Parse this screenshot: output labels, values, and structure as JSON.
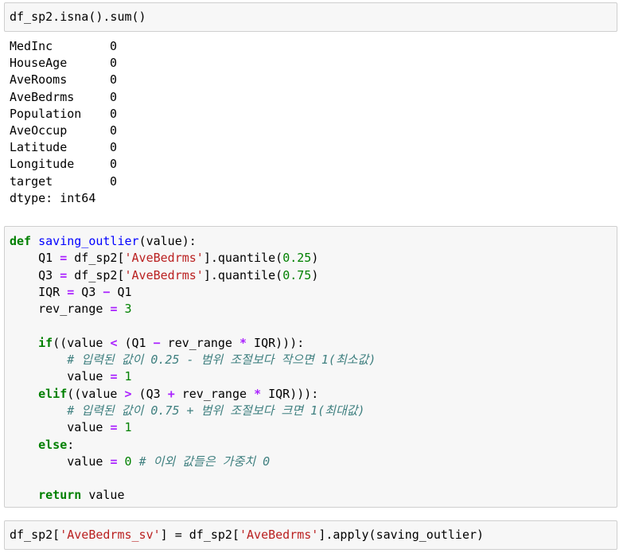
{
  "cell1": {
    "code": "df_sp2.isna().sum()"
  },
  "output": {
    "rows": [
      {
        "name": "MedInc",
        "value": "0"
      },
      {
        "name": "HouseAge",
        "value": "0"
      },
      {
        "name": "AveRooms",
        "value": "0"
      },
      {
        "name": "AveBedrms",
        "value": "0"
      },
      {
        "name": "Population",
        "value": "0"
      },
      {
        "name": "AveOccup",
        "value": "0"
      },
      {
        "name": "Latitude",
        "value": "0"
      },
      {
        "name": "Longitude",
        "value": "0"
      },
      {
        "name": "target",
        "value": "0"
      }
    ],
    "dtype": "dtype: int64"
  },
  "cell2": {
    "def_kw": "def",
    "fn_name": "saving_outlier",
    "fn_params": "(value):",
    "q1_lhs": "Q1 ",
    "q3_lhs": "Q3 ",
    "eq": "=",
    "df_index": " df_sp2[",
    "col_name": "'AveBedrms'",
    "quantile_call": "].quantile(",
    "q1_val": "0.25",
    "q3_val": "0.75",
    "close_paren": ")",
    "iqr_lhs": "IQR ",
    "iqr_rhs_a": " Q3 ",
    "minus": "−",
    "iqr_rhs_b": " Q1",
    "rev_lhs": "rev_range ",
    "rev_val": "3",
    "if_kw": "if",
    "if_a": "((value ",
    "lt": "<",
    "if_b": " (Q1 ",
    "if_c": " rev_range ",
    "mul": "*",
    "if_d": " IQR))):",
    "comment1": "# 입력된 값이 0.25 - 범위 조절보다 작으면 1(최소값)",
    "value_lhs": "value ",
    "one": "1",
    "elif_kw": "elif",
    "gt": ">",
    "elif_b": " (Q3 ",
    "plus": "+",
    "elif_d": " IQR))):",
    "comment2": "# 입력된 값이 0.75 + 범위 조절보다 크면 1(최대값)",
    "else_kw": "else",
    "colon": ":",
    "zero": "0",
    "comment3": "# 이외 값들은 가중치 0",
    "return_kw": "return",
    "return_val": " value"
  },
  "cell3": {
    "lhs": "df_sp2[",
    "new_col": "'AveBedrms_sv'",
    "mid": "] = df_sp2[",
    "col": "'AveBedrms'",
    "apply": "].apply(saving_outlier)"
  }
}
